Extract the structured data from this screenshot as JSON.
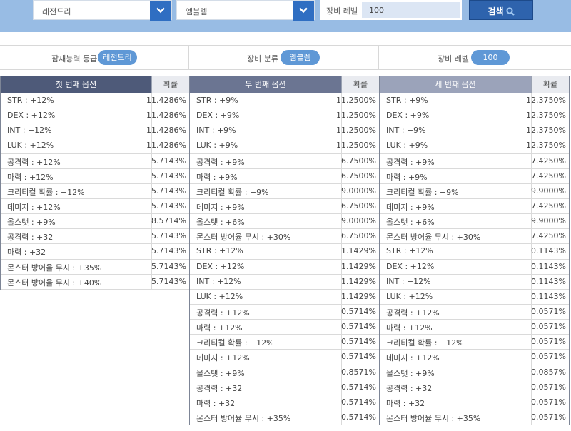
{
  "search": {
    "grade_value": "레전드리",
    "category_value": "엠블렘",
    "level_label": "장비 레벨",
    "level_value": "100",
    "search_label": "검색"
  },
  "summary": {
    "grade_label": "잠재능력 등급",
    "grade_value": "레전드리",
    "category_label": "장비 분류",
    "category_value": "엠블렘",
    "level_label": "장비 레벨",
    "level_value": "100"
  },
  "colors": {
    "accent": "#2f6ec2",
    "pill": "#5f98d6",
    "banner": "#98bce4"
  },
  "tables": [
    {
      "header_option": "첫 번째 옵션",
      "header_prob": "확률",
      "header_bg": "#4e5a79",
      "rows": [
        {
          "option": "STR : +12%",
          "prob": "11.4286%"
        },
        {
          "option": "DEX : +12%",
          "prob": "11.4286%"
        },
        {
          "option": "INT : +12%",
          "prob": "11.4286%"
        },
        {
          "option": "LUK : +12%",
          "prob": "11.4286%"
        },
        {
          "option": "공격력 : +12%",
          "prob": "5.7143%"
        },
        {
          "option": "마력 : +12%",
          "prob": "5.7143%"
        },
        {
          "option": "크리티컬 확률 : +12%",
          "prob": "5.7143%"
        },
        {
          "option": "데미지 : +12%",
          "prob": "5.7143%"
        },
        {
          "option": "올스탯 : +9%",
          "prob": "8.5714%"
        },
        {
          "option": "공격력 : +32",
          "prob": "5.7143%"
        },
        {
          "option": "마력 : +32",
          "prob": "5.7143%"
        },
        {
          "option": "몬스터 방어율 무시 : +35%",
          "prob": "5.7143%"
        },
        {
          "option": "몬스터 방어율 무시 : +40%",
          "prob": "5.7143%"
        }
      ]
    },
    {
      "header_option": "두 번째 옵션",
      "header_prob": "확률",
      "header_bg": "#6b7592",
      "rows": [
        {
          "option": "STR : +9%",
          "prob": "11.2500%"
        },
        {
          "option": "DEX : +9%",
          "prob": "11.2500%"
        },
        {
          "option": "INT : +9%",
          "prob": "11.2500%"
        },
        {
          "option": "LUK : +9%",
          "prob": "11.2500%"
        },
        {
          "option": "공격력 : +9%",
          "prob": "6.7500%"
        },
        {
          "option": "마력 : +9%",
          "prob": "6.7500%"
        },
        {
          "option": "크리티컬 확률 : +9%",
          "prob": "9.0000%"
        },
        {
          "option": "데미지 : +9%",
          "prob": "6.7500%"
        },
        {
          "option": "올스탯 : +6%",
          "prob": "9.0000%"
        },
        {
          "option": "몬스터 방어율 무시 : +30%",
          "prob": "6.7500%"
        },
        {
          "option": "STR : +12%",
          "prob": "1.1429%"
        },
        {
          "option": "DEX : +12%",
          "prob": "1.1429%"
        },
        {
          "option": "INT : +12%",
          "prob": "1.1429%"
        },
        {
          "option": "LUK : +12%",
          "prob": "1.1429%"
        },
        {
          "option": "공격력 : +12%",
          "prob": "0.5714%"
        },
        {
          "option": "마력 : +12%",
          "prob": "0.5714%"
        },
        {
          "option": "크리티컬 확률 : +12%",
          "prob": "0.5714%"
        },
        {
          "option": "데미지 : +12%",
          "prob": "0.5714%"
        },
        {
          "option": "올스탯 : +9%",
          "prob": "0.8571%"
        },
        {
          "option": "공격력 : +32",
          "prob": "0.5714%"
        },
        {
          "option": "마력 : +32",
          "prob": "0.5714%"
        },
        {
          "option": "몬스터 방어율 무시 : +35%",
          "prob": "0.5714%"
        }
      ]
    },
    {
      "header_option": "세 번째 옵션",
      "header_prob": "확률",
      "header_bg": "#9ba3ba",
      "rows": [
        {
          "option": "STR : +9%",
          "prob": "12.3750%"
        },
        {
          "option": "DEX : +9%",
          "prob": "12.3750%"
        },
        {
          "option": "INT : +9%",
          "prob": "12.3750%"
        },
        {
          "option": "LUK : +9%",
          "prob": "12.3750%"
        },
        {
          "option": "공격력 : +9%",
          "prob": "7.4250%"
        },
        {
          "option": "마력 : +9%",
          "prob": "7.4250%"
        },
        {
          "option": "크리티컬 확률 : +9%",
          "prob": "9.9000%"
        },
        {
          "option": "데미지 : +9%",
          "prob": "7.4250%"
        },
        {
          "option": "올스탯 : +6%",
          "prob": "9.9000%"
        },
        {
          "option": "몬스터 방어율 무시 : +30%",
          "prob": "7.4250%"
        },
        {
          "option": "STR : +12%",
          "prob": "0.1143%"
        },
        {
          "option": "DEX : +12%",
          "prob": "0.1143%"
        },
        {
          "option": "INT : +12%",
          "prob": "0.1143%"
        },
        {
          "option": "LUK : +12%",
          "prob": "0.1143%"
        },
        {
          "option": "공격력 : +12%",
          "prob": "0.0571%"
        },
        {
          "option": "마력 : +12%",
          "prob": "0.0571%"
        },
        {
          "option": "크리티컬 확률 : +12%",
          "prob": "0.0571%"
        },
        {
          "option": "데미지 : +12%",
          "prob": "0.0571%"
        },
        {
          "option": "올스탯 : +9%",
          "prob": "0.0857%"
        },
        {
          "option": "공격력 : +32",
          "prob": "0.0571%"
        },
        {
          "option": "마력 : +32",
          "prob": "0.0571%"
        },
        {
          "option": "몬스터 방어율 무시 : +35%",
          "prob": "0.0571%"
        }
      ]
    }
  ]
}
